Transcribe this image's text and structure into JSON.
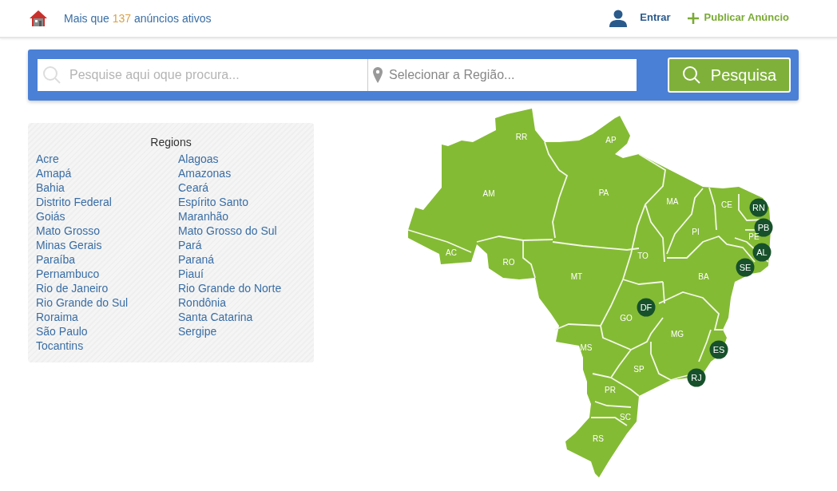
{
  "header": {
    "ads_text": {
      "prefix": "Mais que",
      "count": "137",
      "suffix": "anúncios ativos"
    },
    "login": "Entrar",
    "publish": "Publicar Anúncio"
  },
  "search": {
    "query_placeholder": "Pesquise aqui oque procura...",
    "region_placeholder": "Selecionar a Região...",
    "button": "Pesquisa"
  },
  "regions": {
    "title": "Regions",
    "columns": [
      [
        "Acre",
        "Amapá",
        "Bahia",
        "Distrito Federal",
        "Goiás",
        "Mato Grosso",
        "Minas Gerais",
        "Paraíba",
        "Pernambuco",
        "Rio de Janeiro",
        "Rio Grande do Sul",
        "Roraima",
        "São Paulo",
        "Tocantins"
      ],
      [
        "Alagoas",
        "Amazonas",
        "Ceará",
        "Espírito Santo",
        "Maranhão",
        "Mato Grosso do Sul",
        "Pará",
        "Paraná",
        "Piauí",
        "Rio Grande do Norte",
        "Rondônia",
        "Santa Catarina",
        "Sergipe"
      ]
    ]
  },
  "map": {
    "states": [
      {
        "code": "RR",
        "kind": "label"
      },
      {
        "code": "AP",
        "kind": "label"
      },
      {
        "code": "AM",
        "kind": "label"
      },
      {
        "code": "PA",
        "kind": "label"
      },
      {
        "code": "MA",
        "kind": "label"
      },
      {
        "code": "CE",
        "kind": "label"
      },
      {
        "code": "RN",
        "kind": "marker"
      },
      {
        "code": "PB",
        "kind": "marker"
      },
      {
        "code": "PI",
        "kind": "label"
      },
      {
        "code": "PE",
        "kind": "label"
      },
      {
        "code": "AL",
        "kind": "marker"
      },
      {
        "code": "SE",
        "kind": "marker"
      },
      {
        "code": "AC",
        "kind": "label"
      },
      {
        "code": "RO",
        "kind": "label"
      },
      {
        "code": "TO",
        "kind": "label"
      },
      {
        "code": "MT",
        "kind": "label"
      },
      {
        "code": "BA",
        "kind": "label"
      },
      {
        "code": "DF",
        "kind": "marker"
      },
      {
        "code": "GO",
        "kind": "label"
      },
      {
        "code": "MG",
        "kind": "label"
      },
      {
        "code": "ES",
        "kind": "marker"
      },
      {
        "code": "MS",
        "kind": "label"
      },
      {
        "code": "SP",
        "kind": "label"
      },
      {
        "code": "RJ",
        "kind": "marker"
      },
      {
        "code": "PR",
        "kind": "label"
      },
      {
        "code": "SC",
        "kind": "label"
      },
      {
        "code": "RS",
        "kind": "label"
      }
    ]
  }
}
